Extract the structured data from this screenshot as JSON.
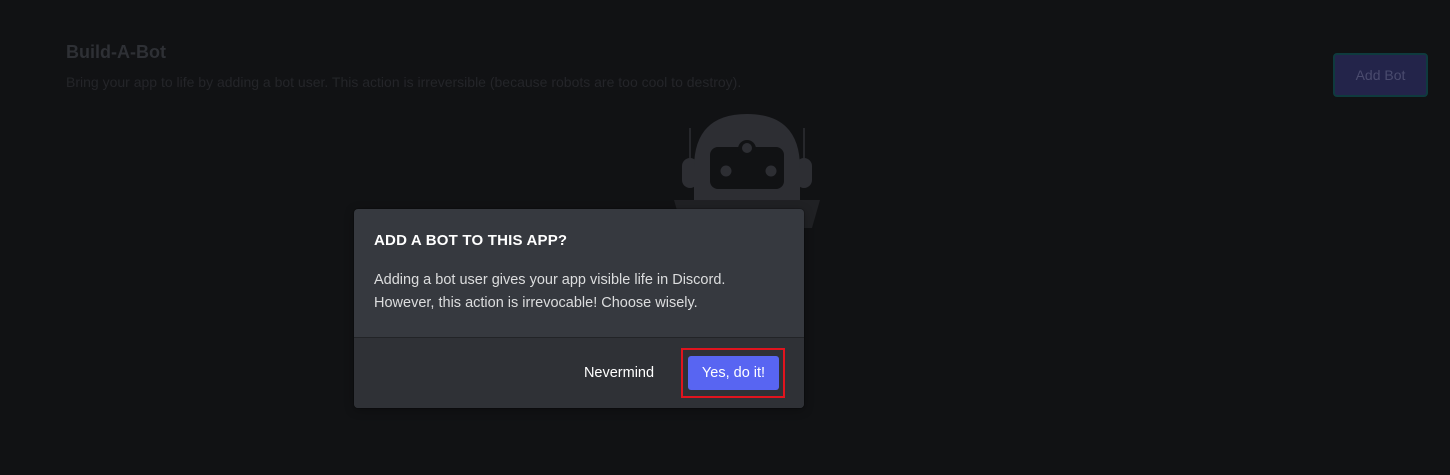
{
  "section": {
    "title": "Build-A-Bot",
    "description": "Bring your app to life by adding a bot user. This action is irreversible (because robots are too cool to destroy).",
    "add_bot_label": "Add Bot"
  },
  "modal": {
    "title": "ADD A BOT TO THIS APP?",
    "body_line1": "Adding a bot user gives your app visible life in Discord.",
    "body_line2": "However, this action is irrevocable! Choose wisely.",
    "cancel_label": "Nevermind",
    "confirm_label": "Yes, do it!"
  },
  "icons": {
    "robot": "robot-illustration-icon"
  },
  "colors": {
    "background": "#111214",
    "modal_background": "#36393f",
    "modal_footer": "#2f3136",
    "confirm_button": "#5865f2",
    "highlight": "#e0141e"
  }
}
